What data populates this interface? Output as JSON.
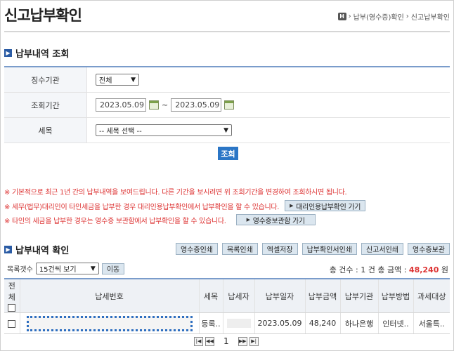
{
  "page": {
    "title": "신고납부확인",
    "breadcrumb": [
      "납부(영수증)확인",
      "신고납부확인"
    ]
  },
  "search_section": {
    "title": "납부내역 조회",
    "rows": {
      "agency": {
        "label": "징수기관",
        "value": "전체"
      },
      "period": {
        "label": "조회기간",
        "from": "2023.05.09",
        "to": "2023.05.09",
        "separator": "~"
      },
      "tax_item": {
        "label": "세목",
        "value": "-- 세목 선택 --"
      }
    },
    "search_button": "조회"
  },
  "notices": [
    {
      "text": "※ 기본적으로 최근 1년 간의 납부내역을 보여드립니다. 다른 기간을 보시려면 위 조회기간을 변경하여 조회하시면 됩니다."
    },
    {
      "text": "※ 세무(법무)대리인이 타인세금을 납부한 경우 대리인용납부확인에서 납부확인을 할 수 있습니다.",
      "button": "대리인용납부확인 가기"
    },
    {
      "text": "※ 타인의 세금을 납부한 경우는 영수증 보관함에서 납부확인을 할 수 있습니다.",
      "button": "영수증보관함 가기"
    }
  ],
  "result_section": {
    "title": "납부내역 확인",
    "tool_buttons": [
      "영수증인쇄",
      "목록인쇄",
      "엑셀저장",
      "납부확인서인쇄",
      "신고서인쇄",
      "영수증보관"
    ],
    "list_count_label": "목록갯수",
    "list_count_value": "15건씩 보기",
    "move_button": "이동",
    "summary_prefix": "총 건수 : 1 건 총 금액 : ",
    "summary_amount": "48,240",
    "summary_unit": " 원",
    "columns": [
      "전체",
      "납세번호",
      "세목",
      "납세자",
      "납부일자",
      "납부금액",
      "납부기관",
      "납부방법",
      "과세대상"
    ],
    "rows": [
      {
        "tax_item": "등록..",
        "payer": "",
        "date": "2023.05.09",
        "amount": "48,240",
        "bank": "하나은행",
        "method": "인터넷..",
        "target": "서울특.."
      }
    ],
    "pagination": {
      "current": "1"
    }
  },
  "colors": {
    "accent": "#2b76c6",
    "notice": "#dd3333",
    "highlight": "#2f6fc0"
  }
}
